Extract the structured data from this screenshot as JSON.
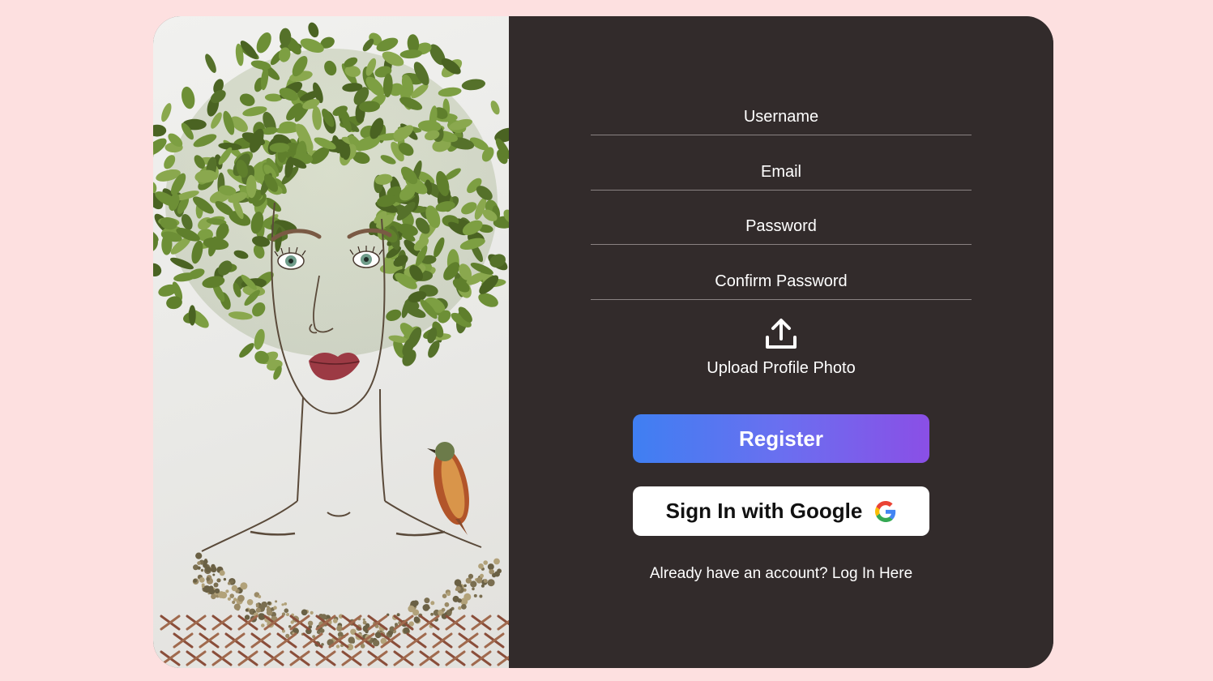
{
  "art": {
    "alt": "Leaf portrait artwork of a woman with green leaf hair and a small bird on her shoulder"
  },
  "form": {
    "username_placeholder": "Username",
    "email_placeholder": "Email",
    "password_placeholder": "Password",
    "confirm_password_placeholder": "Confirm Password",
    "upload_icon": "upload-icon",
    "upload_label": "Upload Profile Photo",
    "register_label": "Register",
    "google_label": "Sign In with Google",
    "google_icon": "google-logo-icon",
    "login_prompt": "Already have an account?",
    "login_link": "Log In Here"
  },
  "colors": {
    "page_background": "#fde0e0",
    "panel_background": "#322b2b",
    "register_gradient_start": "#3f7ff2",
    "register_gradient_end": "#8a4fe6",
    "google_button": "#ffffff"
  }
}
